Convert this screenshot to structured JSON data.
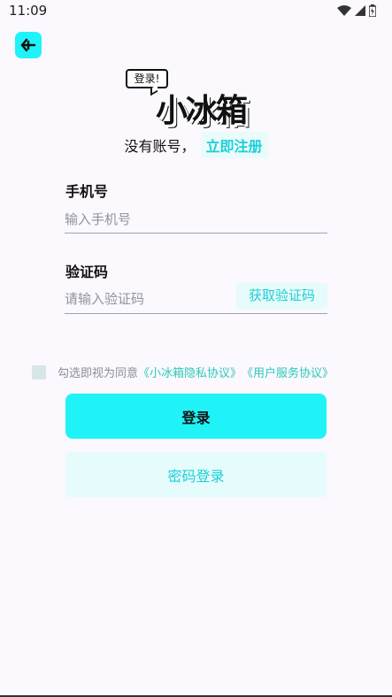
{
  "status_bar": {
    "time": "11:09",
    "icons": [
      "wifi-icon",
      "signal-icon",
      "battery-icon"
    ]
  },
  "back_button": {
    "icon": "back-arrow-icon"
  },
  "logo": {
    "bubble_text": "登录!",
    "brand_text": "小冰箱"
  },
  "signup": {
    "prompt": "没有账号，",
    "link": "立即注册"
  },
  "phone": {
    "label": "手机号",
    "placeholder": "输入手机号",
    "value": ""
  },
  "code": {
    "label": "验证码",
    "placeholder": "请输入验证码",
    "value": "",
    "get_code_label": "获取验证码"
  },
  "agreement": {
    "checked": false,
    "prefix": "勾选即视为同意",
    "privacy_link": "《小冰箱隐私协议》",
    "service_link": "《用户服务协议》"
  },
  "login_label": "登录",
  "password_login_label": "密码登录",
  "colors": {
    "accent": "#1ff3f8",
    "accent_text": "#1ccfd6",
    "link_green": "#2dc9b7",
    "background": "#fbf8fe"
  }
}
